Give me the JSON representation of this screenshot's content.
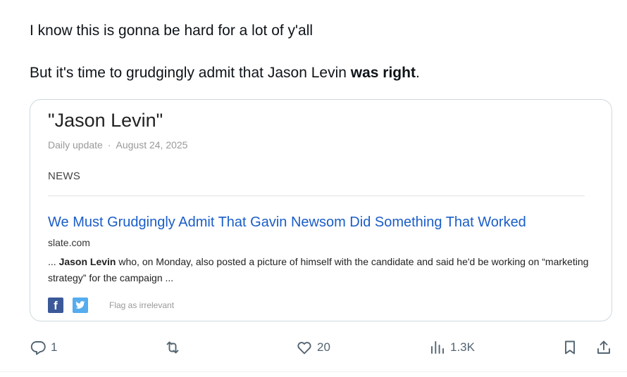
{
  "tweet": {
    "line1": "I know this is gonna be hard for a lot of y'all",
    "line2_prefix": "But it's time to grudgingly admit that Jason Levin ",
    "line2_bold": "was right",
    "line2_suffix": "."
  },
  "card": {
    "title": "\"Jason Levin\"",
    "frequency": "Daily update",
    "separator": "·",
    "date": "August 24, 2025",
    "section": "NEWS",
    "headline": "We Must Grudgingly Admit That Gavin Newsom Did Something That Worked",
    "source": "slate.com",
    "snippet_prefix": "... ",
    "snippet_bold": "Jason Levin",
    "snippet_rest": " who, on Monday, also posted a picture of himself with the candidate and said he'd be working on “marketing strategy” for the campaign ...",
    "facebook_label": "f",
    "flag_label": "Flag as irrelevant"
  },
  "actions": {
    "replies": "1",
    "reposts": "",
    "likes": "20",
    "views": "1.3K"
  },
  "colors": {
    "link": "#1a5dc8",
    "facebook": "#3b5998",
    "twitter": "#55acee",
    "action_gray": "#536471"
  },
  "icons": [
    "reply-icon",
    "repost-icon",
    "like-icon",
    "views-icon",
    "bookmark-icon",
    "share-icon",
    "facebook-icon",
    "twitter-icon"
  ]
}
